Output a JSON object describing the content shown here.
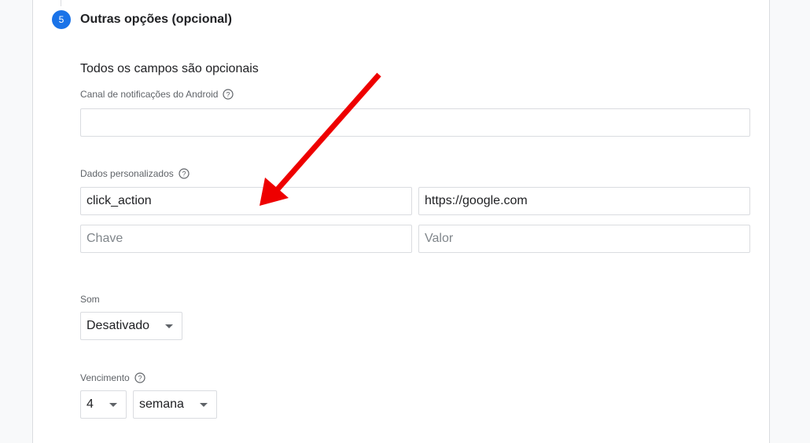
{
  "step": {
    "number": "5",
    "title": "Outras opções (opcional)"
  },
  "form": {
    "subtitle": "Todos os campos são opcionais",
    "android_channel": {
      "label": "Canal de notificações do Android",
      "value": ""
    },
    "custom_data": {
      "label": "Dados personalizados",
      "rows": [
        {
          "key": "click_action",
          "value": "https://google.com"
        }
      ],
      "key_placeholder": "Chave",
      "value_placeholder": "Valor"
    },
    "sound": {
      "label": "Som",
      "selected": "Desativado"
    },
    "expiration": {
      "label": "Vencimento",
      "amount": "4",
      "unit": "semana"
    }
  },
  "annotation": {
    "arrow_color": "#ee0000"
  },
  "colors": {
    "accent": "#1a73e8",
    "border": "#dadce0",
    "label": "#5f6368"
  }
}
